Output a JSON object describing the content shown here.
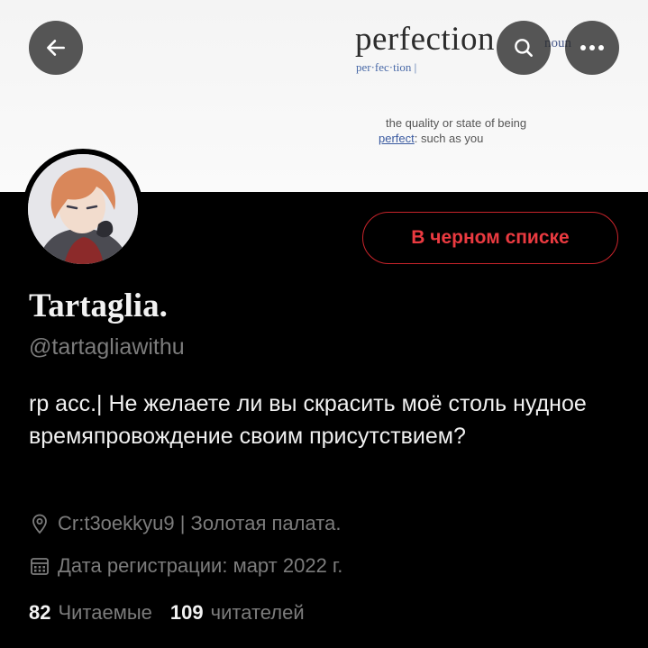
{
  "banner": {
    "word": "perfection",
    "pos": "noun",
    "phonetic": "per·fec·tion |",
    "definition_line1": "the quality or state of being",
    "definition_link": "perfect",
    "definition_line2_rest": ": such as you"
  },
  "header": {
    "back_icon": "arrow-left-icon",
    "search_icon": "search-icon",
    "more_icon": "more-horizontal-icon"
  },
  "profile": {
    "block_label": "В черном списке",
    "name": "Tartaglia.",
    "handle": "@tartagliawithu",
    "bio": "rp acc.| Не желаете ли вы скрасить моё столь нудное времяпровождение своим присутствием?",
    "location": "Cr:t3oekkyu9 | Золотая палата.",
    "joined": "Дата регистрации: март 2022 г.",
    "following_count": "82",
    "following_label": "Читаемые",
    "followers_count": "109",
    "followers_label": "читателей"
  },
  "colors": {
    "accent_red": "#ea3a40",
    "muted": "#7c7c7c",
    "background": "#000000"
  }
}
